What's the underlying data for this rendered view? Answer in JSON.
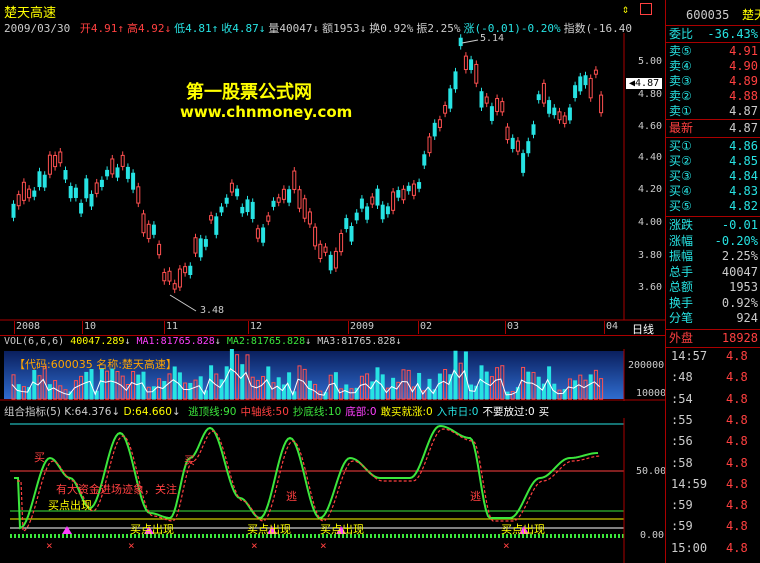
{
  "title": {
    "stock_name": "楚天高速",
    "right_code": "600035",
    "right_name": "楚天"
  },
  "quote_bar": {
    "date": "2009/03/30",
    "items": [
      {
        "label": "开",
        "value": "4.91",
        "arrow": "↑",
        "color": "#ff4040"
      },
      {
        "label": "高",
        "value": "4.92",
        "arrow": "↓",
        "color": "#ff4040"
      },
      {
        "label": "低",
        "value": "4.81",
        "arrow": "↑",
        "color": "#27e3e3"
      },
      {
        "label": "收",
        "value": "4.87",
        "arrow": "↓",
        "color": "#27e3e3"
      },
      {
        "label": "量",
        "value": "40047",
        "arrow": "↓",
        "color": "#cccccc"
      },
      {
        "label": "额",
        "value": "1953",
        "arrow": "↓",
        "color": "#cccccc"
      },
      {
        "label": "换",
        "value": "0.92%",
        "arrow": "",
        "color": "#cccccc"
      },
      {
        "label": "振",
        "value": "2.25%",
        "arrow": "",
        "color": "#cccccc"
      },
      {
        "label": "涨",
        "value": "(-0.01)-0.20%",
        "arrow": "",
        "color": "#27e3e3"
      },
      {
        "label": "指数",
        "value": "(-16.40",
        "arrow": "",
        "color": "#cccccc"
      }
    ]
  },
  "watermark": {
    "line1": "第一股票公式网",
    "line2": "www.chnmoney.com"
  },
  "price_axis": {
    "ticks": [
      "5.00",
      "4.80",
      "4.60",
      "4.40",
      "4.20",
      "4.00",
      "3.80",
      "3.60"
    ],
    "current": "4.87",
    "high_label": "5.14",
    "low_label": "3.48"
  },
  "date_axis": {
    "labels": [
      "2008",
      "10",
      "11",
      "12",
      "2009",
      "02",
      "03",
      "04"
    ],
    "period": "日线"
  },
  "vol_header": {
    "text": "VOL(6,6,6)",
    "v1": "40047.289",
    "ma1": "MA1:81765.828",
    "ma2": "MA2:81765.828",
    "ma3": "MA3:81765.828"
  },
  "vol_banner": {
    "text": "【代码:600035 名称:楚天高速】"
  },
  "vol_axis": {
    "ticks": [
      "200000",
      "100000"
    ]
  },
  "ind_header": {
    "name": "组合指标(5)",
    "k": "K:64.376",
    "d": "D:64.660",
    "items": [
      {
        "t": "逃顶线:90",
        "color": "#3ce63c"
      },
      {
        "t": "中轴线:50",
        "color": "#ff4040"
      },
      {
        "t": "抄底线:10",
        "color": "#3ce63c"
      },
      {
        "t": "底部:0",
        "color": "#ff40ff"
      },
      {
        "t": "敢买就涨:0",
        "color": "#ffff00"
      },
      {
        "t": "入市日:0",
        "color": "#27e3e3"
      },
      {
        "t": "不要放过:0",
        "color": "#ffffff"
      },
      {
        "t": "买",
        "color": "#ffffff"
      }
    ]
  },
  "ind_axis": {
    "ticks": [
      "50.00",
      "0.00"
    ]
  },
  "ind_labels": {
    "buy": "买",
    "escape": "逃",
    "bigfund": "有大资金进场迹象，关注",
    "buypoint": "买点出现"
  },
  "right_panel": {
    "webi_label": "委比",
    "webi": "-36.43%",
    "asks": [
      {
        "label": "卖⑤",
        "price": "4.91",
        "color": "#ff4040"
      },
      {
        "label": "卖④",
        "price": "4.90",
        "color": "#ff4040"
      },
      {
        "label": "卖③",
        "price": "4.89",
        "color": "#ff4040"
      },
      {
        "label": "卖②",
        "price": "4.88",
        "color": "#ff4040"
      },
      {
        "label": "卖①",
        "price": "4.87",
        "color": "#cccccc"
      }
    ],
    "latest": {
      "label": "最新",
      "price": "4.87"
    },
    "bids": [
      {
        "label": "买①",
        "price": "4.86",
        "color": "#27e3e3"
      },
      {
        "label": "买②",
        "price": "4.85",
        "color": "#27e3e3"
      },
      {
        "label": "买③",
        "price": "4.84",
        "color": "#27e3e3"
      },
      {
        "label": "买④",
        "price": "4.83",
        "color": "#27e3e3"
      },
      {
        "label": "买⑤",
        "price": "4.82",
        "color": "#27e3e3"
      }
    ],
    "stats": [
      {
        "label": "涨跌",
        "value": "-0.01",
        "color": "#27e3e3"
      },
      {
        "label": "涨幅",
        "value": "-0.20%",
        "color": "#27e3e3"
      },
      {
        "label": "振幅",
        "value": "2.25%",
        "color": "#cccccc"
      },
      {
        "label": "总手",
        "value": "40047",
        "color": "#cccccc"
      },
      {
        "label": "总额",
        "value": "1953",
        "color": "#cccccc"
      },
      {
        "label": "换手",
        "value": "0.92%",
        "color": "#cccccc"
      },
      {
        "label": "分笔",
        "value": "924",
        "color": "#cccccc"
      }
    ],
    "waipan": {
      "label": "外盘",
      "value": "18928"
    },
    "ticks": [
      {
        "t": "14:57",
        "v": "4.8"
      },
      {
        "t": ":48",
        "v": "4.8"
      },
      {
        "t": ":54",
        "v": "4.8"
      },
      {
        "t": ":55",
        "v": "4.8"
      },
      {
        "t": ":56",
        "v": "4.8"
      },
      {
        "t": ":58",
        "v": "4.8"
      },
      {
        "t": "14:59",
        "v": "4.8"
      },
      {
        "t": ":59",
        "v": "4.8"
      },
      {
        "t": ":59",
        "v": "4.8"
      },
      {
        "t": "15:00",
        "v": "4.8"
      }
    ]
  }
}
